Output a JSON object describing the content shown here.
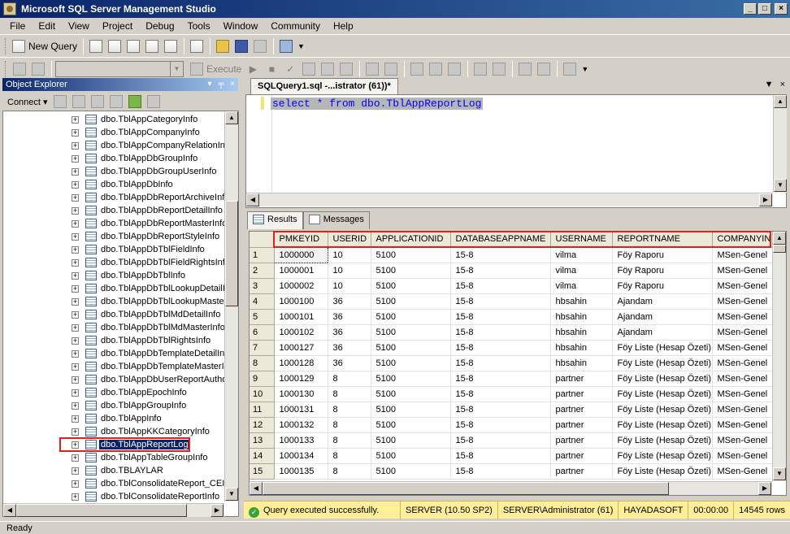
{
  "window": {
    "title": "Microsoft SQL Server Management Studio"
  },
  "menu": [
    "File",
    "Edit",
    "View",
    "Project",
    "Debug",
    "Tools",
    "Window",
    "Community",
    "Help"
  ],
  "toolbar": {
    "new_query_label": "New Query",
    "execute_label": "Execute"
  },
  "object_explorer": {
    "title": "Object Explorer",
    "connect_label": "Connect",
    "items": [
      "dbo.TblAppCategoryInfo",
      "dbo.TblAppCompanyInfo",
      "dbo.TblAppCompanyRelationInfo",
      "dbo.TblAppDbGroupInfo",
      "dbo.TblAppDbGroupUserInfo",
      "dbo.TblAppDbInfo",
      "dbo.TblAppDbReportArchiveInfo",
      "dbo.TblAppDbReportDetailInfo",
      "dbo.TblAppDbReportMasterInfo",
      "dbo.TblAppDbReportStyleInfo",
      "dbo.TblAppDbTblFieldInfo",
      "dbo.TblAppDbTblFieldRightsInfo",
      "dbo.TblAppDbTblInfo",
      "dbo.TblAppDbTblLookupDetailIn",
      "dbo.TblAppDbTblLookupMasterIn",
      "dbo.TblAppDbTblMdDetailInfo",
      "dbo.TblAppDbTblMdMasterInfo",
      "dbo.TblAppDbTblRightsInfo",
      "dbo.TblAppDbTemplateDetailInfo",
      "dbo.TblAppDbTemplateMasterIn",
      "dbo.TblAppDbUserReportAuthor",
      "dbo.TblAppEpochInfo",
      "dbo.TblAppGroupInfo",
      "dbo.TblAppInfo",
      "dbo.TblAppKKCategoryInfo",
      "dbo.TblAppReportLog",
      "dbo.TblAppTableGroupInfo",
      "dbo.TBLAYLAR",
      "dbo.TblConsolidateReport_CEIn",
      "dbo.TblConsolidateReportInfo"
    ],
    "selected_index": 25
  },
  "editor": {
    "tab_title": "SQLQuery1.sql -...istrator (61))*",
    "sql": "select * from dbo.TblAppReportLog"
  },
  "results": {
    "tab_results": "Results",
    "tab_messages": "Messages",
    "columns": [
      "PMKEYID",
      "USERID",
      "APPLICATIONID",
      "DATABASEAPPNAME",
      "USERNAME",
      "REPORTNAME",
      "COMPANYIN"
    ],
    "rows": [
      [
        "1",
        "1000000",
        "10",
        "5100",
        "15-8",
        "vilma",
        "Föy Raporu",
        "MSen-Genel"
      ],
      [
        "2",
        "1000001",
        "10",
        "5100",
        "15-8",
        "vilma",
        "Föy Raporu",
        "MSen-Genel"
      ],
      [
        "3",
        "1000002",
        "10",
        "5100",
        "15-8",
        "vilma",
        "Föy Raporu",
        "MSen-Genel"
      ],
      [
        "4",
        "1000100",
        "36",
        "5100",
        "15-8",
        "hbsahin",
        "Ajandam",
        "MSen-Genel"
      ],
      [
        "5",
        "1000101",
        "36",
        "5100",
        "15-8",
        "hbsahin",
        "Ajandam",
        "MSen-Genel"
      ],
      [
        "6",
        "1000102",
        "36",
        "5100",
        "15-8",
        "hbsahin",
        "Ajandam",
        "MSen-Genel"
      ],
      [
        "7",
        "1000127",
        "36",
        "5100",
        "15-8",
        "hbsahin",
        "Föy Liste (Hesap Özeti)",
        "MSen-Genel"
      ],
      [
        "8",
        "1000128",
        "36",
        "5100",
        "15-8",
        "hbsahin",
        "Föy Liste (Hesap Özeti)",
        "MSen-Genel"
      ],
      [
        "9",
        "1000129",
        "8",
        "5100",
        "15-8",
        "partner",
        "Föy Liste (Hesap Özeti)",
        "MSen-Genel"
      ],
      [
        "10",
        "1000130",
        "8",
        "5100",
        "15-8",
        "partner",
        "Föy Liste (Hesap Özeti)",
        "MSen-Genel"
      ],
      [
        "11",
        "1000131",
        "8",
        "5100",
        "15-8",
        "partner",
        "Föy Liste (Hesap Özeti)",
        "MSen-Genel"
      ],
      [
        "12",
        "1000132",
        "8",
        "5100",
        "15-8",
        "partner",
        "Föy Liste (Hesap Özeti)",
        "MSen-Genel"
      ],
      [
        "13",
        "1000133",
        "8",
        "5100",
        "15-8",
        "partner",
        "Föy Liste (Hesap Özeti)",
        "MSen-Genel"
      ],
      [
        "14",
        "1000134",
        "8",
        "5100",
        "15-8",
        "partner",
        "Föy Liste (Hesap Özeti)",
        "MSen-Genel"
      ],
      [
        "15",
        "1000135",
        "8",
        "5100",
        "15-8",
        "partner",
        "Föy Liste (Hesap Özeti)",
        "MSen-Genel"
      ]
    ]
  },
  "query_status": {
    "message": "Query executed successfully.",
    "server": "SERVER (10.50 SP2)",
    "user": "SERVER\\Administrator (61)",
    "database": "HAYADASOFT",
    "elapsed": "00:00:00",
    "rows": "14545 rows"
  },
  "statusbar": {
    "text": "Ready"
  },
  "colors": {
    "title_bar": "#0a246a",
    "highlight_box": "#e02020",
    "status_strip": "#ffef9a"
  }
}
